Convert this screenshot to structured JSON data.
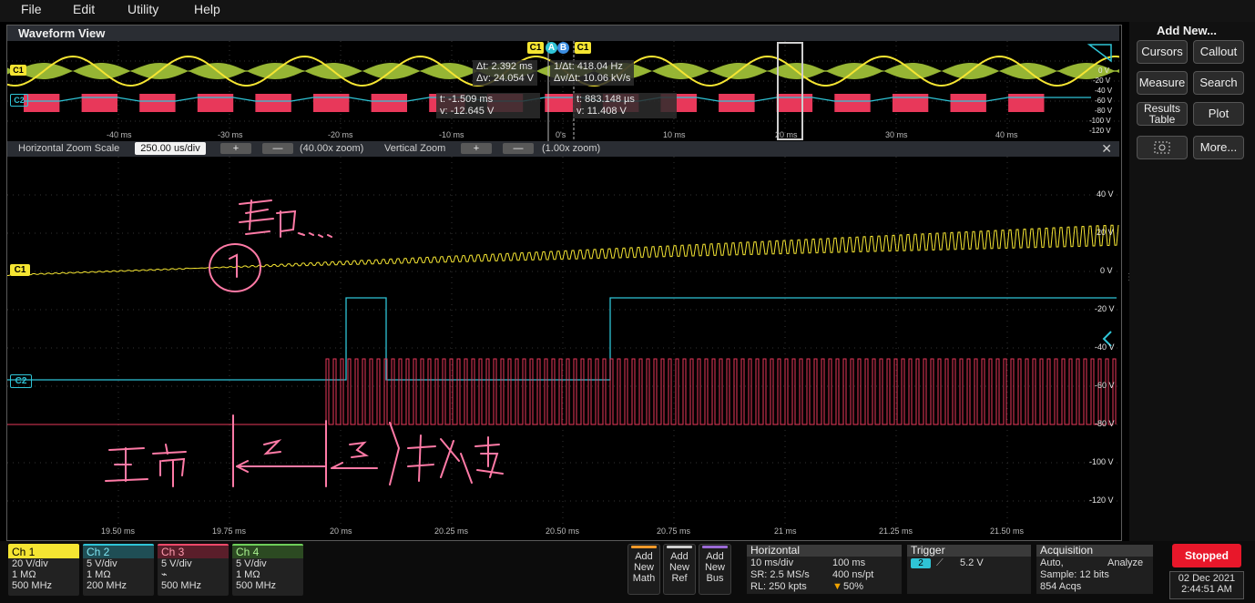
{
  "menu": [
    "File",
    "Edit",
    "Utility",
    "Help"
  ],
  "waveform_view": {
    "title": "Waveform View",
    "overview": {
      "time_ticks": [
        "-40 ms",
        "-30 ms",
        "-20 ms",
        "-10 ms",
        "0's",
        "10 ms",
        "20 ms",
        "30 ms",
        "40 ms"
      ],
      "volt_ticks": [
        "0 V",
        "-20 V",
        "-40 V",
        "-60 V",
        "-80 V",
        "-100 V",
        "-120 V"
      ],
      "ch1_label": "C1",
      "ch2_label": "C2",
      "cursor_tags": [
        "C1",
        "A",
        "B",
        "C1"
      ],
      "readouts": {
        "dt": "Δt: 2.392 ms",
        "inv_dt": "1/Δt: 418.04 Hz",
        "dv": "Δv: 24.054 V",
        "dv_dt": "Δv/Δt: 10.06 kV/s",
        "a_time": "t: -1.509 ms",
        "a_volt": "v: -12.645 V",
        "b_time": "t: 883.148 µs",
        "b_volt": "v: 11.408 V"
      }
    },
    "zoom_bar": {
      "horizontal_label": "Horizontal Zoom Scale",
      "horizontal_value": "250.00 us/div",
      "horizontal_zoom": "(40.00x zoom)",
      "vertical_label": "Vertical Zoom",
      "vertical_zoom": "(1.00x zoom)",
      "plus": "+",
      "minus": "—",
      "close": "✕"
    },
    "main_plot": {
      "time_ticks": [
        "19.50 ms",
        "19.75 ms",
        "20 ms",
        "20.25 ms",
        "20.50 ms",
        "20.75 ms",
        "21 ms",
        "21.25 ms",
        "21.50 ms"
      ],
      "volt_ticks": [
        "40 V",
        "20 V",
        "0 V",
        "-20 V",
        "-40 V",
        "-60 V",
        "-80 V",
        "-100 V",
        "-120 V"
      ],
      "ch1_label": "C1",
      "ch2_label": "C2"
    }
  },
  "right_panel": {
    "title": "Add New...",
    "buttons": [
      "Cursors",
      "Callout",
      "Measure",
      "Search",
      "Results Table",
      "Plot",
      "More..."
    ]
  },
  "channels": [
    {
      "name": "Ch 1",
      "vdiv": "20 V/div",
      "imp": "1 MΩ",
      "bw": "500 MHz",
      "color": "#f5e532"
    },
    {
      "name": "Ch 2",
      "vdiv": "5 V/div",
      "imp": "1 MΩ",
      "bw": "200 MHz",
      "color": "#2fc4d6"
    },
    {
      "name": "Ch 3",
      "vdiv": "5 V/div",
      "imp": "",
      "bw": "500 MHz",
      "color": "#ef4a6a"
    },
    {
      "name": "Ch 4",
      "vdiv": "5 V/div",
      "imp": "1 MΩ",
      "bw": "500 MHz",
      "color": "#6fcf5a"
    }
  ],
  "add_buttons": [
    {
      "l1": "Add",
      "l2": "New",
      "l3": "Math",
      "color": "#f29a2a"
    },
    {
      "l1": "Add",
      "l2": "New",
      "l3": "Ref",
      "color": "#cfcfcf"
    },
    {
      "l1": "Add",
      "l2": "New",
      "l3": "Bus",
      "color": "#9b6bd6"
    }
  ],
  "horizontal": {
    "title": "Horizontal",
    "scale": "10 ms/div",
    "record": "100 ms",
    "sr": "SR: 2.5 MS/s",
    "ns_pt": "400 ns/pt",
    "rl": "RL: 250 kpts",
    "position": "50%"
  },
  "trigger": {
    "title": "Trigger",
    "source": "2",
    "level": "5.2 V"
  },
  "acquisition": {
    "title": "Acquisition",
    "mode": "Auto,",
    "analyze": "Analyze",
    "sample": "Sample: 12 bits",
    "acqs": "854 Acqs"
  },
  "status": {
    "state": "Stopped",
    "date": "02 Dec 2021",
    "time": "2:44:51 AM"
  },
  "colors": {
    "ch1": "#f5e532",
    "ch2": "#2fc4d6",
    "ch3": "#e8385a",
    "annotation": "#ff7aa6"
  }
}
